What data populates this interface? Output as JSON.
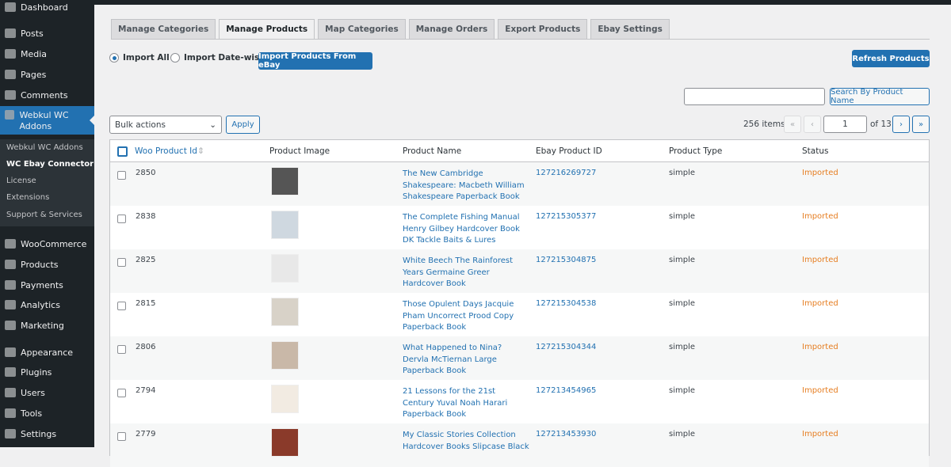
{
  "sidebar": {
    "items": [
      {
        "label": "Dashboard",
        "icon": "dashboard-icon"
      },
      {
        "label": "Posts",
        "icon": "pin-icon"
      },
      {
        "label": "Media",
        "icon": "media-icon"
      },
      {
        "label": "Pages",
        "icon": "pages-icon"
      },
      {
        "label": "Comments",
        "icon": "comment-icon"
      },
      {
        "label": "Webkul WC Addons",
        "icon": "bag-icon"
      },
      {
        "label": "WooCommerce",
        "icon": "woo-icon"
      },
      {
        "label": "Products",
        "icon": "archive-icon"
      },
      {
        "label": "Payments",
        "icon": "dollar-icon"
      },
      {
        "label": "Analytics",
        "icon": "chart-icon"
      },
      {
        "label": "Marketing",
        "icon": "megaphone-icon"
      },
      {
        "label": "Appearance",
        "icon": "brush-icon"
      },
      {
        "label": "Plugins",
        "icon": "plug-icon"
      },
      {
        "label": "Users",
        "icon": "user-icon"
      },
      {
        "label": "Tools",
        "icon": "wrench-icon"
      },
      {
        "label": "Settings",
        "icon": "settings-icon"
      }
    ],
    "submenu": [
      "Webkul WC Addons",
      "WC Ebay Connector",
      "License",
      "Extensions",
      "Support & Services"
    ]
  },
  "tabs": [
    "Manage Categories",
    "Manage Products",
    "Map Categories",
    "Manage Orders",
    "Export Products",
    "Ebay Settings"
  ],
  "active_tab": "Manage Products",
  "import": {
    "option_all": "Import All",
    "option_datewise": "Import Date-wise",
    "selected": "Import All",
    "button": "Import Products From eBay"
  },
  "refresh_button": "Refresh Products",
  "search": {
    "value": "",
    "button": "Search By Product Name"
  },
  "bulk": {
    "selected": "Bulk actions",
    "apply": "Apply"
  },
  "pagination": {
    "items": "256 items",
    "first": "«",
    "prev": "‹",
    "current": "1",
    "of": "of 13",
    "next": "›",
    "last": "»"
  },
  "columns": [
    "Woo Product Id",
    "Product Image",
    "Product Name",
    "Ebay Product ID",
    "Product Type",
    "Status"
  ],
  "rows": [
    {
      "id": "2850",
      "name": "The New Cambridge Shakespeare: Macbeth William Shakespeare Paperback Book",
      "ebay_id": "127216269727",
      "type": "simple",
      "status": "Imported"
    },
    {
      "id": "2838",
      "name": "The Complete Fishing Manual Henry Gilbey Hardcover Book DK Tackle Baits & Lures",
      "ebay_id": "127215305377",
      "type": "simple",
      "status": "Imported"
    },
    {
      "id": "2825",
      "name": "White Beech The Rainforest Years Germaine Greer Hardcover Book",
      "ebay_id": "127215304875",
      "type": "simple",
      "status": "Imported"
    },
    {
      "id": "2815",
      "name": "Those Opulent Days Jacquie Pham Uncorrect Prood Copy Paperback Book",
      "ebay_id": "127215304538",
      "type": "simple",
      "status": "Imported"
    },
    {
      "id": "2806",
      "name": "What Happened to Nina? Dervla McTiernan Large Paperback Book",
      "ebay_id": "127215304344",
      "type": "simple",
      "status": "Imported"
    },
    {
      "id": "2794",
      "name": "21 Lessons for the 21st Century Yuval Noah Harari Paperback Book",
      "ebay_id": "127213454965",
      "type": "simple",
      "status": "Imported"
    },
    {
      "id": "2779",
      "name": "My Classic Stories Collection Hardcover Books Slipcase Black",
      "ebay_id": "127213453930",
      "type": "simple",
      "status": "Imported"
    }
  ],
  "colors": {
    "accent": "#2271b1",
    "sidebar": "#1d2327",
    "status_imported": "#e67e22"
  }
}
